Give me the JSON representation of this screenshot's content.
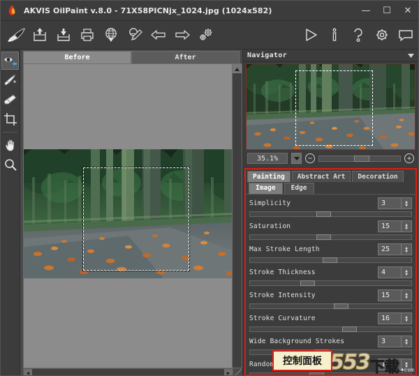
{
  "window": {
    "title": "AKVIS OilPaint v.8.0 - 71X58PICNjx_1024.jpg (1024x582)",
    "app_name": "AKVIS OilPaint",
    "version": "v.8.0",
    "file_name": "71X58PICNjx_1024.jpg",
    "image_size": "(1024x582)",
    "minimize_label": "—",
    "maximize_label": "☐",
    "close_label": "✕",
    "logo_icon": "akvis-flame-logo"
  },
  "toolbar": {
    "left_items": [
      {
        "name": "brush-logo-icon",
        "label": "Brush"
      },
      {
        "name": "open-image-icon",
        "label": "Open Image"
      },
      {
        "name": "save-image-icon",
        "label": "Save Image"
      },
      {
        "name": "print-image-icon",
        "label": "Print Image"
      },
      {
        "name": "publish-web-icon",
        "label": "Publish Image"
      },
      {
        "name": "share-image-icon",
        "label": "Share Image"
      },
      {
        "name": "undo-arrow-icon",
        "label": "Undo"
      },
      {
        "name": "redo-arrow-icon",
        "label": "Redo"
      },
      {
        "name": "batch-gears-icon",
        "label": "Batch Processing"
      }
    ],
    "right_items": [
      {
        "name": "run-play-icon",
        "label": "Run"
      },
      {
        "name": "info-icon",
        "label": "Info"
      },
      {
        "name": "help-question-icon",
        "label": "Help"
      },
      {
        "name": "preferences-gear-icon",
        "label": "Preferences"
      },
      {
        "name": "comment-bubble-icon",
        "label": "Comments"
      }
    ]
  },
  "tools": {
    "items": [
      {
        "name": "preview-eye-icon",
        "label": "Quick Preview",
        "selected": true
      },
      {
        "name": "history-brush-icon",
        "label": "History Brush",
        "selected": false
      },
      {
        "name": "eraser-icon",
        "label": "Eraser",
        "selected": false
      },
      {
        "name": "crop-icon",
        "label": "Crop",
        "selected": false
      },
      {
        "name": "hand-icon",
        "label": "Hand",
        "selected": false
      },
      {
        "name": "zoom-magnifier-icon",
        "label": "Zoom",
        "selected": false
      }
    ]
  },
  "canvas": {
    "tabs": [
      {
        "label": "Before",
        "active": true
      },
      {
        "label": "After",
        "active": false
      }
    ],
    "scroll_up_label": "▲",
    "scroll_left_label": "◀",
    "scroll_right_label": "▶"
  },
  "navigator": {
    "title": "Navigator",
    "collapse_icon": "chevron-down-icon",
    "zoom_value": "35.1%",
    "zoom_dropdown_icon": "chevron-down-icon",
    "zoom_out_label": "−",
    "zoom_in_label": "+"
  },
  "settings": {
    "main_tabs": [
      {
        "label": "Painting",
        "active": true
      },
      {
        "label": "Abstract Art",
        "active": false
      },
      {
        "label": "Decoration",
        "active": false
      }
    ],
    "sub_tabs": [
      {
        "label": "Image",
        "active": true
      },
      {
        "label": "Edge",
        "active": false
      }
    ],
    "spin_up_label": "▴",
    "spin_down_label": "▾",
    "parameters": [
      {
        "label": "Simplicity",
        "value": "3",
        "knob_pct": 41
      },
      {
        "label": "Saturation",
        "value": "15",
        "knob_pct": 41
      },
      {
        "label": "Max Stroke Length",
        "value": "25",
        "knob_pct": 45
      },
      {
        "label": "Stroke Thickness",
        "value": "4",
        "knob_pct": 31
      },
      {
        "label": "Stroke Intensity",
        "value": "15",
        "knob_pct": 52
      },
      {
        "label": "Stroke Curvature",
        "value": "16",
        "knob_pct": 57
      },
      {
        "label": "Wide Background Strokes",
        "value": "3",
        "knob_pct": 40
      },
      {
        "label": "Random Strokes",
        "value": "10",
        "knob_pct": 37
      }
    ]
  },
  "annotation": {
    "callout_text": "控制面板"
  },
  "watermark": {
    "number": "9553",
    "chinese": "下载",
    "domain": "♦com"
  }
}
